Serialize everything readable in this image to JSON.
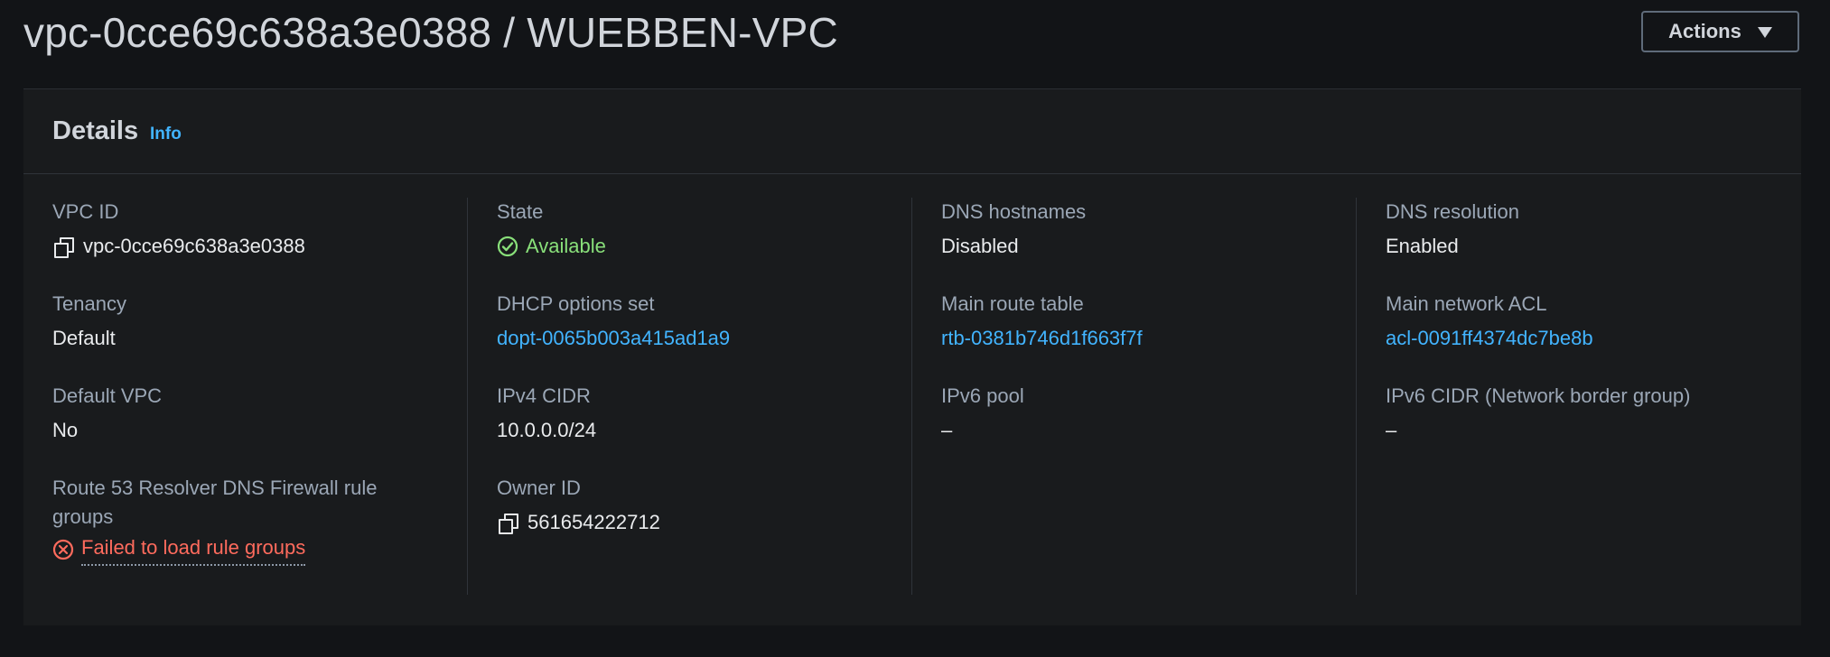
{
  "header": {
    "title": "vpc-0cce69c638a3e0388 / WUEBBEN-VPC",
    "actions_label": "Actions"
  },
  "details": {
    "title": "Details",
    "info_label": "Info",
    "columns": [
      {
        "fields": [
          {
            "label": "VPC ID",
            "value": "vpc-0cce69c638a3e0388",
            "kind": "copy"
          },
          {
            "label": "Tenancy",
            "value": "Default",
            "kind": "text"
          },
          {
            "label": "Default VPC",
            "value": "No",
            "kind": "text"
          },
          {
            "label": "Route 53 Resolver DNS Firewall rule groups",
            "value": "Failed to load rule groups",
            "kind": "error"
          }
        ]
      },
      {
        "fields": [
          {
            "label": "State",
            "value": "Available",
            "kind": "success"
          },
          {
            "label": "DHCP options set",
            "value": "dopt-0065b003a415ad1a9",
            "kind": "link"
          },
          {
            "label": "IPv4 CIDR",
            "value": "10.0.0.0/24",
            "kind": "text"
          },
          {
            "label": "Owner ID",
            "value": "561654222712",
            "kind": "copy"
          }
        ]
      },
      {
        "fields": [
          {
            "label": "DNS hostnames",
            "value": "Disabled",
            "kind": "text"
          },
          {
            "label": "Main route table",
            "value": "rtb-0381b746d1f663f7f",
            "kind": "link"
          },
          {
            "label": "IPv6 pool",
            "value": "–",
            "kind": "text"
          }
        ]
      },
      {
        "fields": [
          {
            "label": "DNS resolution",
            "value": "Enabled",
            "kind": "text"
          },
          {
            "label": "Main network ACL",
            "value": "acl-0091ff4374dc7be8b",
            "kind": "link"
          },
          {
            "label": "IPv6 CIDR (Network border group)",
            "value": "–",
            "kind": "text"
          }
        ]
      }
    ]
  },
  "colors": {
    "background": "#121417",
    "panel": "#191b1d",
    "link": "#42b4ff",
    "success": "#89e07a",
    "error": "#ff6b5d"
  }
}
